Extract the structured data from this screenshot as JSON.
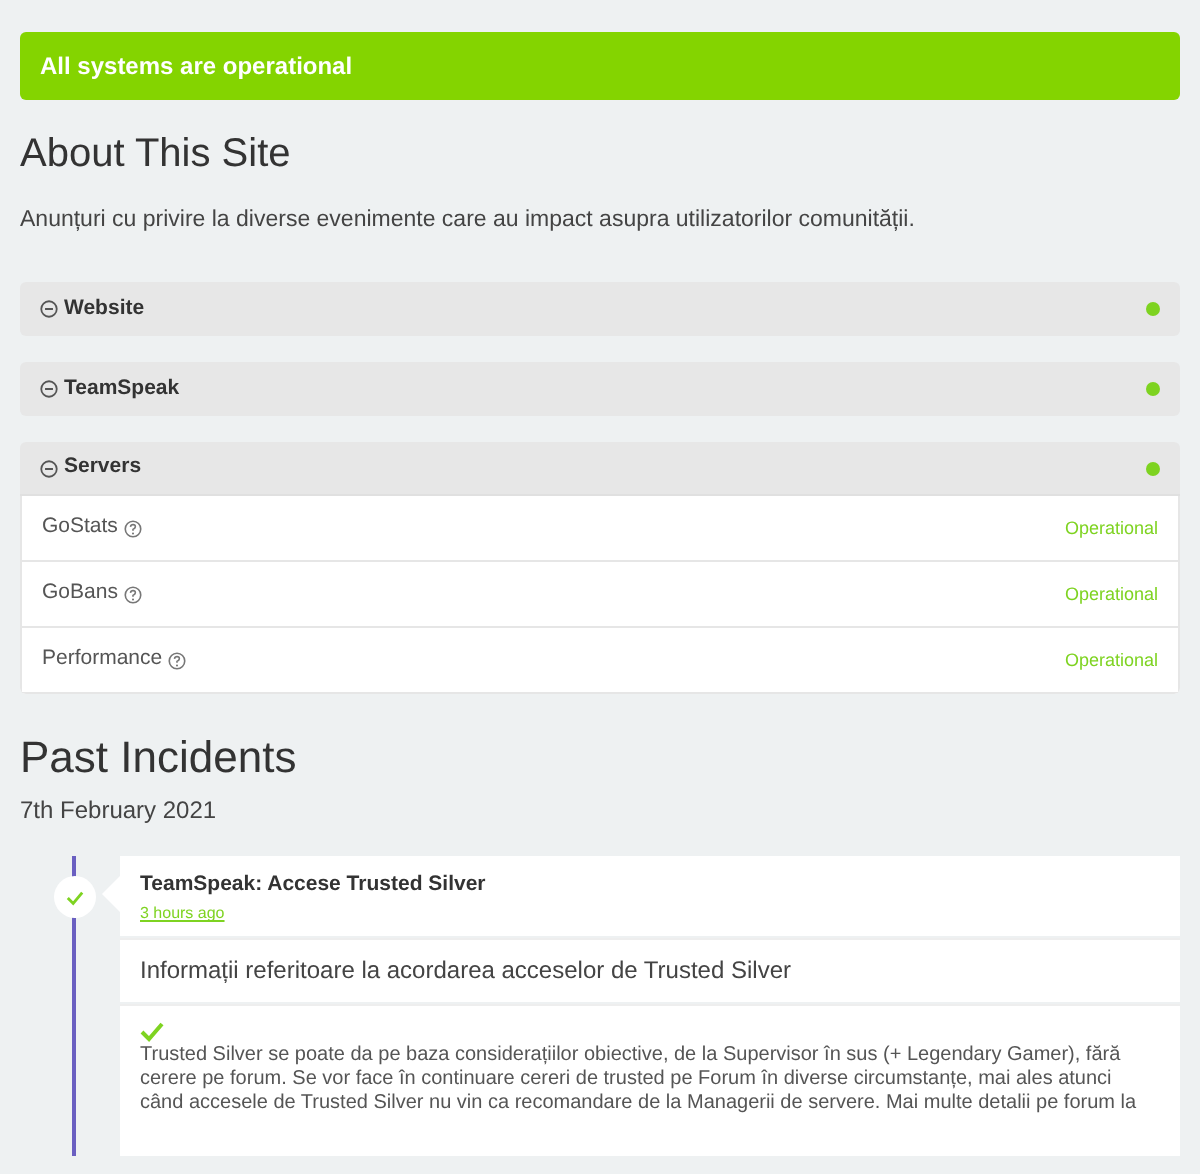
{
  "banner": {
    "text": "All systems are operational",
    "color": "#84d400"
  },
  "about": {
    "title": "About This Site",
    "description": "Anunțuri cu privire la diverse evenimente care au impact asupra utilizatorilor comunității."
  },
  "groups": [
    {
      "name": "Website",
      "expanded": false,
      "color": "#7ed321"
    },
    {
      "name": "TeamSpeak",
      "expanded": false,
      "color": "#7ed321"
    },
    {
      "name": "Servers",
      "expanded": true,
      "color": "#7ed321",
      "components": [
        {
          "name": "GoStats",
          "status": "Operational"
        },
        {
          "name": "GoBans",
          "status": "Operational"
        },
        {
          "name": "Performance",
          "status": "Operational"
        }
      ]
    }
  ],
  "past_incidents": {
    "title": "Past Incidents",
    "date": "7th February 2021",
    "incidents": [
      {
        "title": "TeamSpeak: Accese Trusted Silver",
        "time": "3 hours ago",
        "summary": "Informații referitoare la acordarea acceselor de Trusted Silver",
        "body": "Trusted Silver se poate da pe baza considerațiilor obiective, de la Supervisor în sus (+ Legendary Gamer), fără cerere pe forum. Se vor face în continuare cereri de trusted pe Forum în diverse circumstanțe, mai ales atunci când accesele de Trusted Silver nu vin ca recomandare de la Managerii de servere. Mai multe detalii pe forum la"
      }
    ]
  }
}
